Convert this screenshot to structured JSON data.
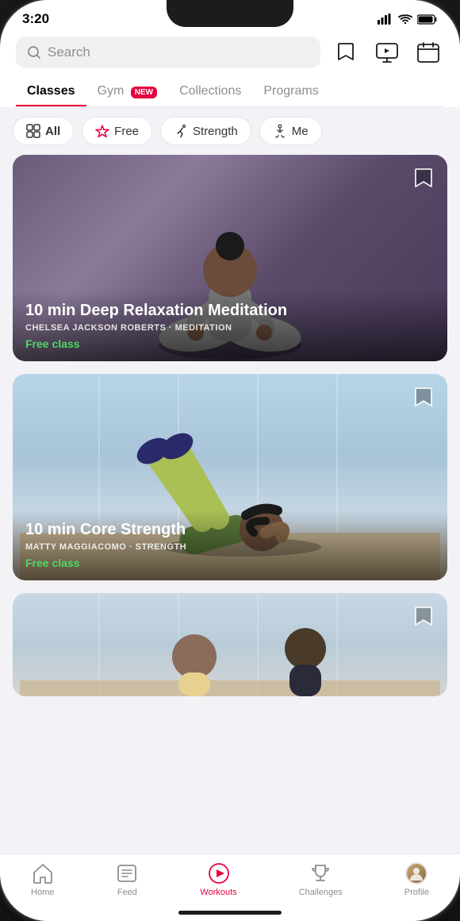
{
  "statusBar": {
    "time": "3:20"
  },
  "header": {
    "searchPlaceholder": "Search"
  },
  "tabs": [
    {
      "label": "Classes",
      "active": true
    },
    {
      "label": "Gym",
      "badge": "NEW",
      "active": false
    },
    {
      "label": "Collections",
      "active": false
    },
    {
      "label": "Programs",
      "active": false
    }
  ],
  "filters": [
    {
      "label": "All",
      "icon": "grid-icon",
      "active": true
    },
    {
      "label": "Free",
      "icon": "star-icon",
      "active": false
    },
    {
      "label": "Strength",
      "icon": "run-icon",
      "active": false
    },
    {
      "label": "Me",
      "icon": "yoga-icon",
      "active": false
    }
  ],
  "cards": [
    {
      "title": "10 min Deep Relaxation Meditation",
      "instructor": "CHELSEA JACKSON ROBERTS",
      "category": "MEDITATION",
      "badge": "Free class",
      "type": "meditation"
    },
    {
      "title": "10 min Core Strength",
      "instructor": "MATTY MAGGIACOMO",
      "category": "STRENGTH",
      "badge": "Free class",
      "type": "strength"
    },
    {
      "title": "",
      "instructor": "",
      "category": "",
      "badge": "",
      "type": "third"
    }
  ],
  "bottomNav": [
    {
      "label": "Home",
      "icon": "home-icon",
      "active": false
    },
    {
      "label": "Feed",
      "icon": "feed-icon",
      "active": false
    },
    {
      "label": "Workouts",
      "icon": "play-icon",
      "active": true
    },
    {
      "label": "Challenges",
      "icon": "trophy-icon",
      "active": false
    },
    {
      "label": "Profile",
      "icon": "profile-icon",
      "active": false
    }
  ]
}
